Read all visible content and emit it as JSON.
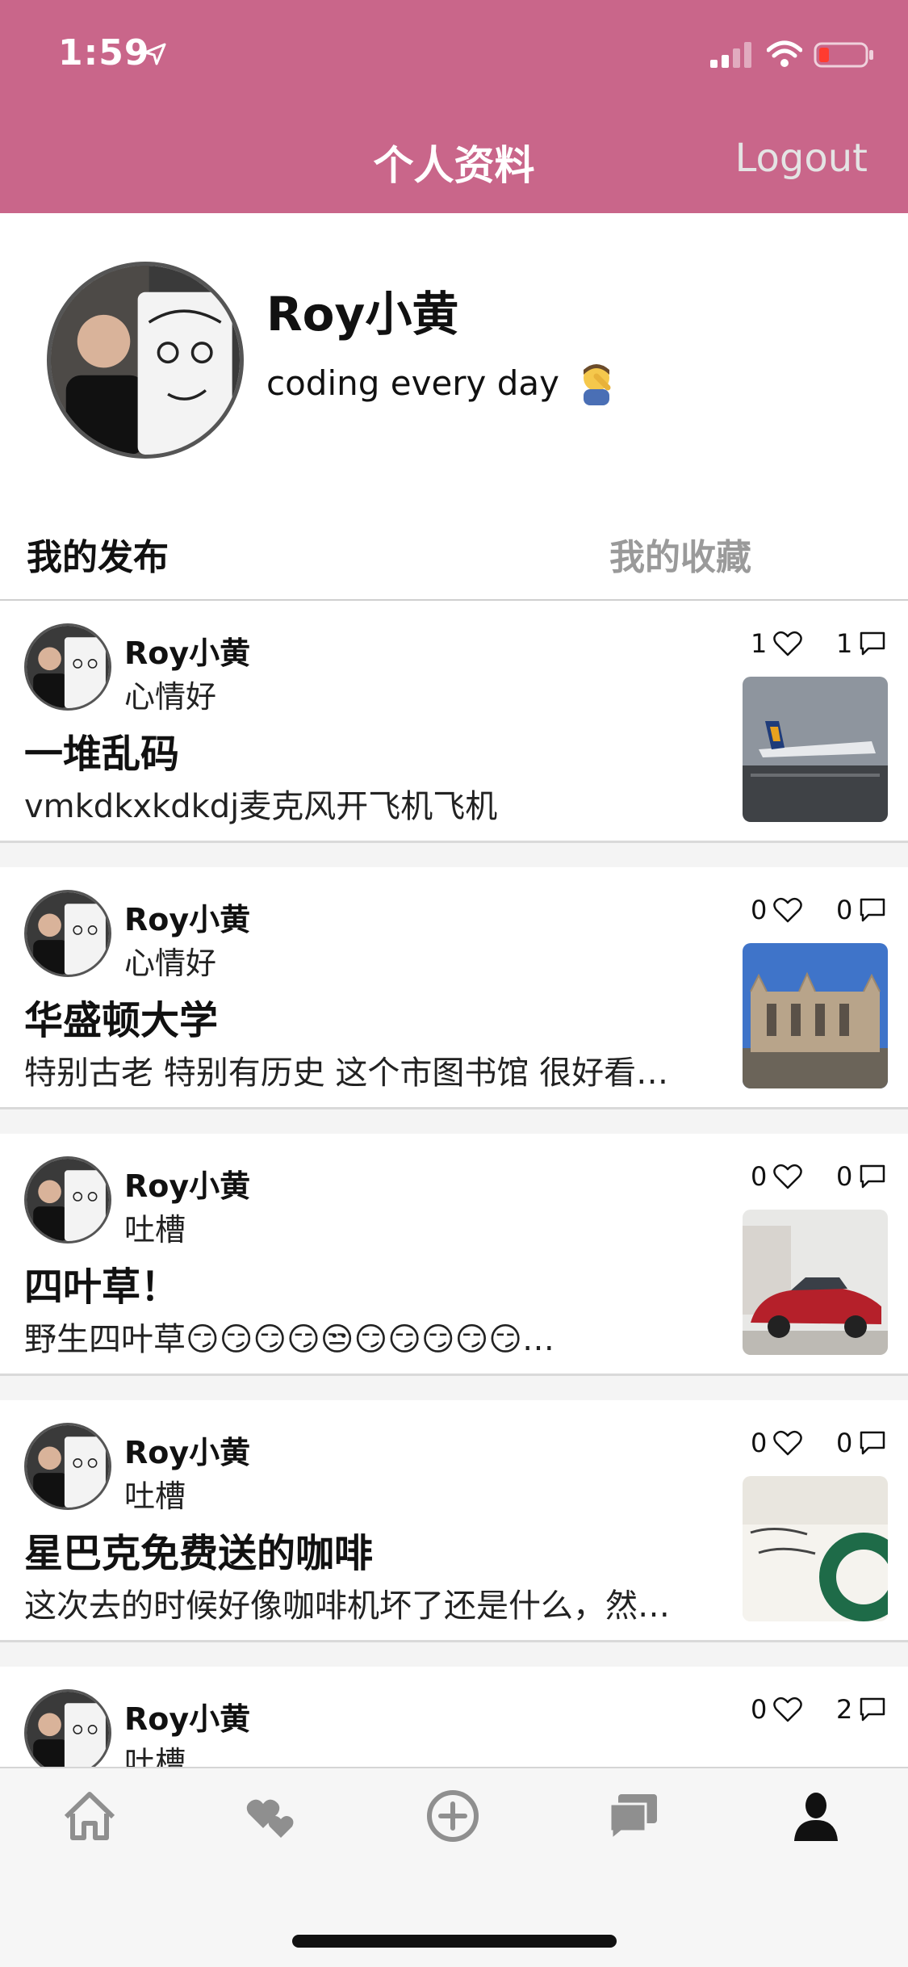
{
  "status_bar": {
    "time": "1:59"
  },
  "nav": {
    "title": "个人资料",
    "logout_label": "Logout"
  },
  "profile": {
    "name": "Roy小黄",
    "bio": "coding every day"
  },
  "tabs": [
    {
      "label": "我的发布",
      "active": true
    },
    {
      "label": "我的收藏",
      "active": false
    }
  ],
  "posts": [
    {
      "user": "Roy小黄",
      "mood": "心情好",
      "title": "一堆乱码",
      "excerpt": "vmkdkxkdkdj麦克风开飞机飞机",
      "likes": "1",
      "comments": "1",
      "thumb": "airplane-photo"
    },
    {
      "user": "Roy小黄",
      "mood": "心情好",
      "title": "华盛顿大学",
      "excerpt": "特别古老 特别有历史 这个市图书馆  很好看…",
      "likes": "0",
      "comments": "0",
      "thumb": "library-photo"
    },
    {
      "user": "Roy小黄",
      "mood": "吐槽",
      "title": "四叶草！",
      "excerpt": "野生四叶草😏😏😏😏😒😏😏😏😏😏…",
      "likes": "0",
      "comments": "0",
      "thumb": "car-photo"
    },
    {
      "user": "Roy小黄",
      "mood": "吐槽",
      "title": "星巴克免费送的咖啡",
      "excerpt": "这次去的时候好像咖啡机坏了还是什么，然…",
      "likes": "0",
      "comments": "0",
      "thumb": "starbucks-card-photo"
    },
    {
      "user": "Roy小黄",
      "mood": "吐槽",
      "title": "",
      "excerpt": "",
      "likes": "0",
      "comments": "2",
      "thumb": ""
    }
  ],
  "tabbar": {
    "items": [
      {
        "icon": "home-icon"
      },
      {
        "icon": "hearts-icon"
      },
      {
        "icon": "add-circle-icon"
      },
      {
        "icon": "messages-icon"
      },
      {
        "icon": "profile-icon",
        "active": true
      }
    ]
  },
  "colors": {
    "accent": "#c9668a",
    "inactive_tab": "#9a9a9a",
    "tabbar_icon": "#8f8f8f"
  }
}
